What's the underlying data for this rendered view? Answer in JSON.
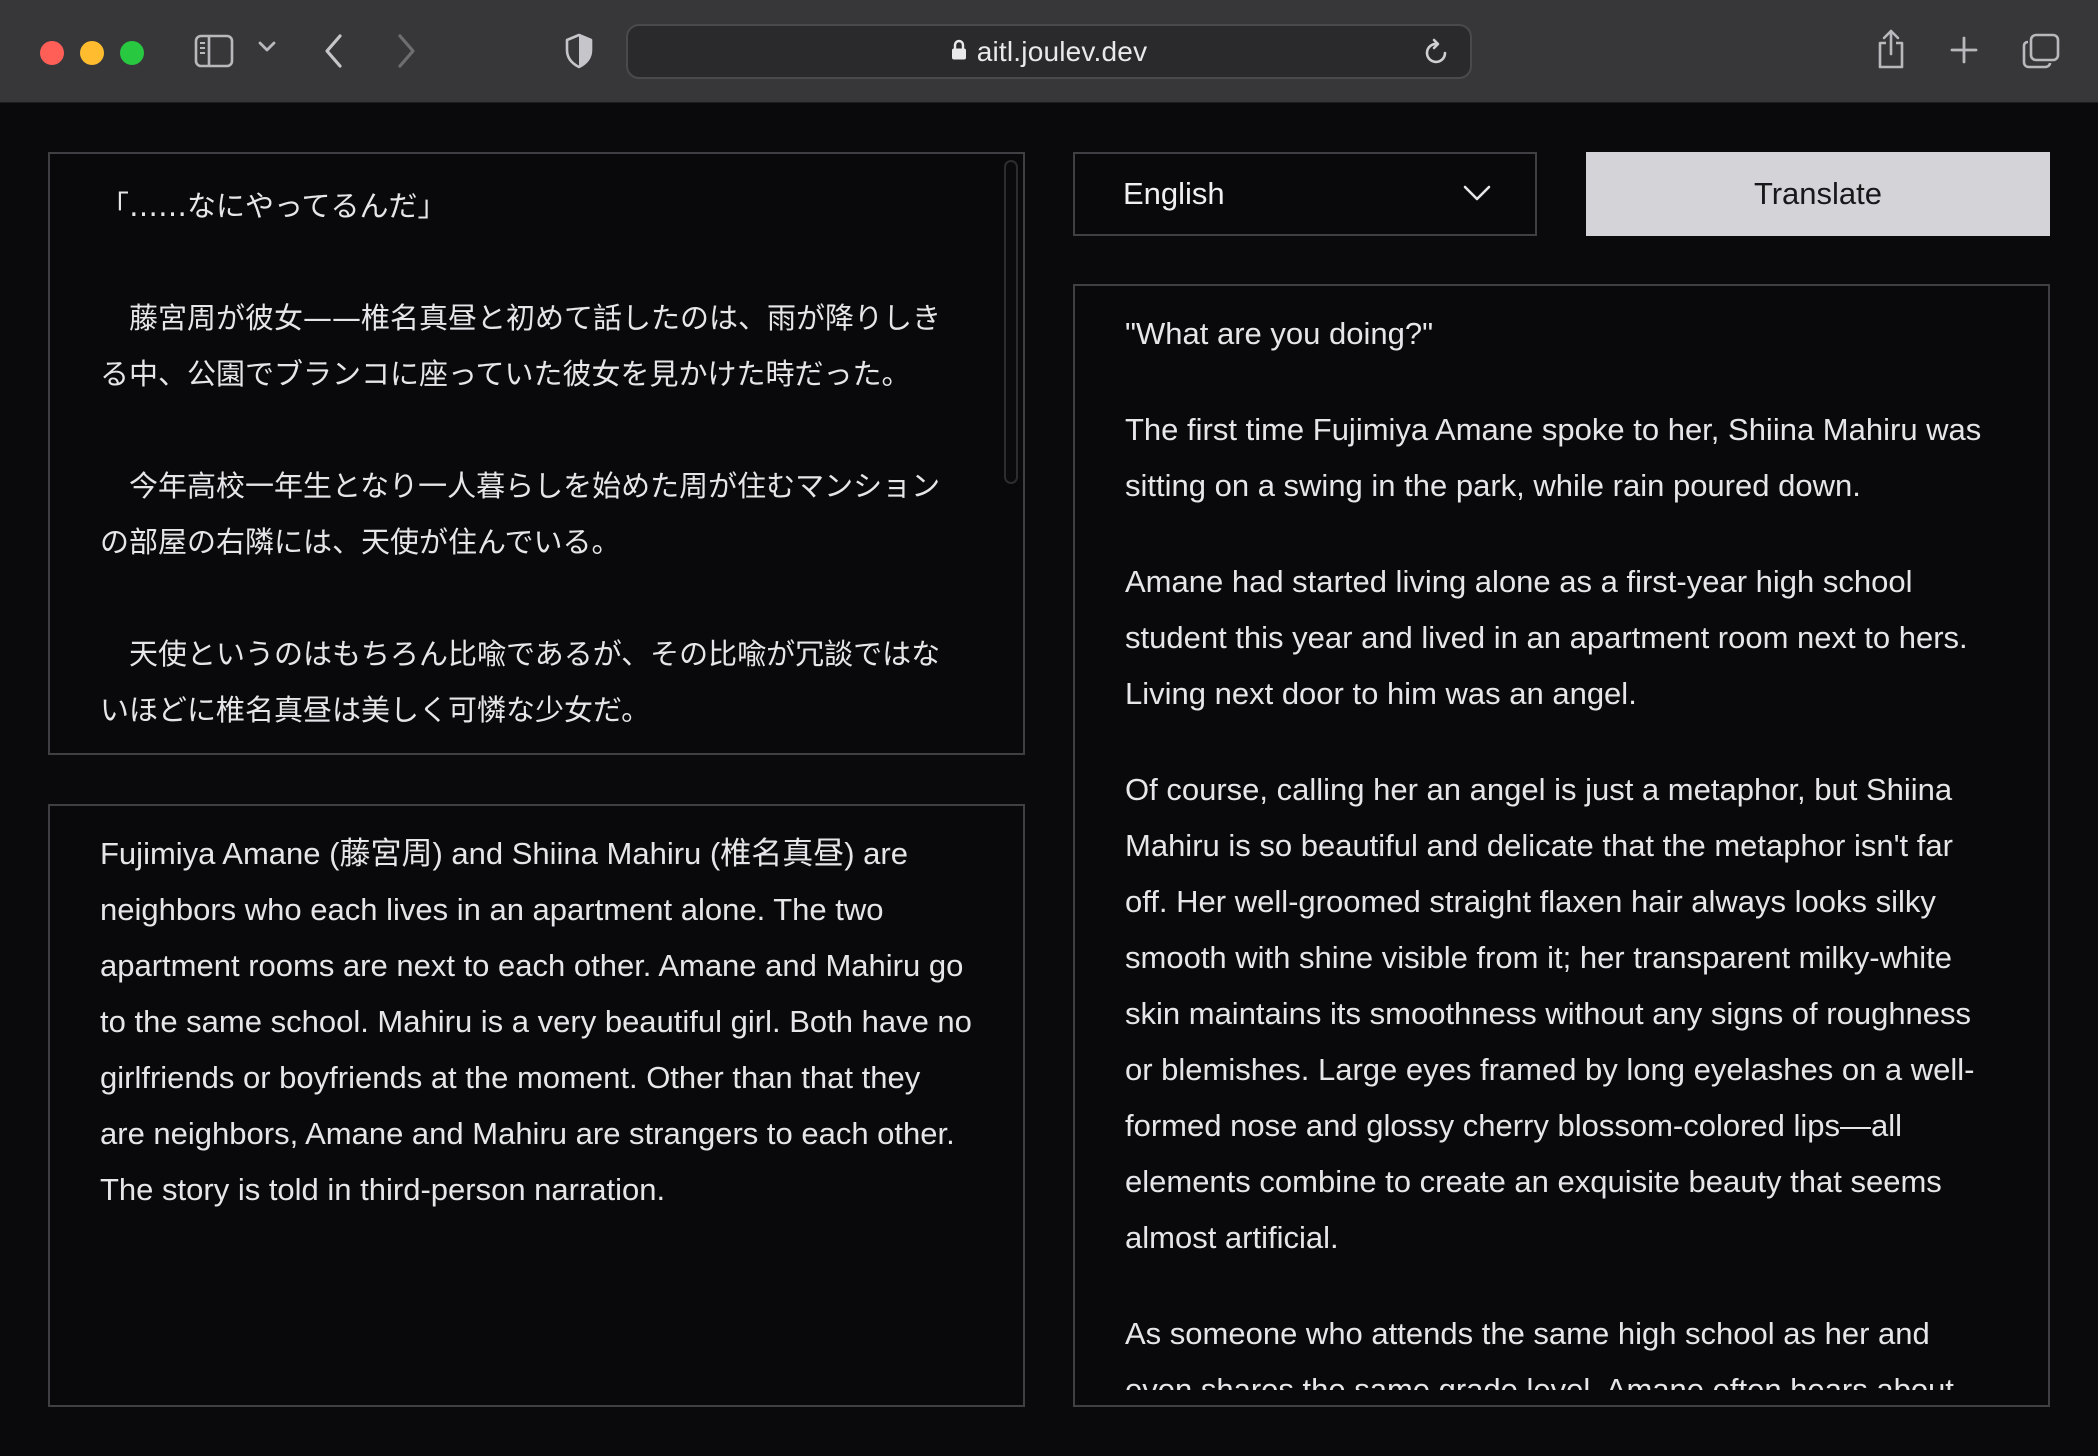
{
  "browser": {
    "url": "aitl.joulev.dev",
    "icons": {
      "sidebar": "sidebar-icon",
      "sidebar_menu": "chevron-down-icon",
      "back": "chevron-left-icon",
      "forward": "chevron-right-icon",
      "privacy": "shield-icon",
      "lock": "lock-icon",
      "reload": "reload-icon",
      "share": "share-icon",
      "new_tab": "plus-icon",
      "tabs": "tabs-overview-icon"
    }
  },
  "source": {
    "paragraphs": [
      "「……なにやってるんだ」",
      "　藤宮周が彼女——椎名真昼と初めて話したのは、雨が降りしきる中、公園でブランコに座っていた彼女を見かけた時だった。",
      "　今年高校一年生となり一人暮らしを始めた周が住むマンションの部屋の右隣には、天使が住んでいる。",
      "　天使というのはもちろん比喩であるが、その比喩が冗談ではないほどに椎名真昼は美しく可憐な少女だ。"
    ]
  },
  "context": {
    "text": "Fujimiya Amane (藤宮周) and Shiina Mahiru (椎名真昼) are neighbors who each lives in an apartment alone. The two apartment rooms are next to each other. Amane and Mahiru go to the same school. Mahiru is a very beautiful girl. Both have no girlfriends or boyfriends at the moment. Other than that they are neighbors, Amane and Mahiru are strangers to each other. The story is told in third-person narration."
  },
  "controls": {
    "language": "English",
    "translate_label": "Translate"
  },
  "output": {
    "paragraphs": [
      "\"What are you doing?\"",
      "The first time Fujimiya Amane spoke to her, Shiina Mahiru was sitting on a swing in the park, while rain poured down.",
      "Amane had started living alone as a first-year high school student this year and lived in an apartment room next to hers. Living next door to him was an angel.",
      "Of course, calling her an angel is just a metaphor, but Shiina Mahiru is so beautiful and delicate that the metaphor isn't far off. Her well-groomed straight flaxen hair always looks silky smooth with shine visible from it; her transparent milky-white skin maintains its smoothness without any signs of roughness or blemishes. Large eyes framed by long eyelashes on a well-formed nose and glossy cherry blossom-colored lips—all elements combine to create an exquisite beauty that seems almost artificial.",
      "As someone who attends the same high school as her and even shares the same grade level, Amane often hears about"
    ]
  }
}
